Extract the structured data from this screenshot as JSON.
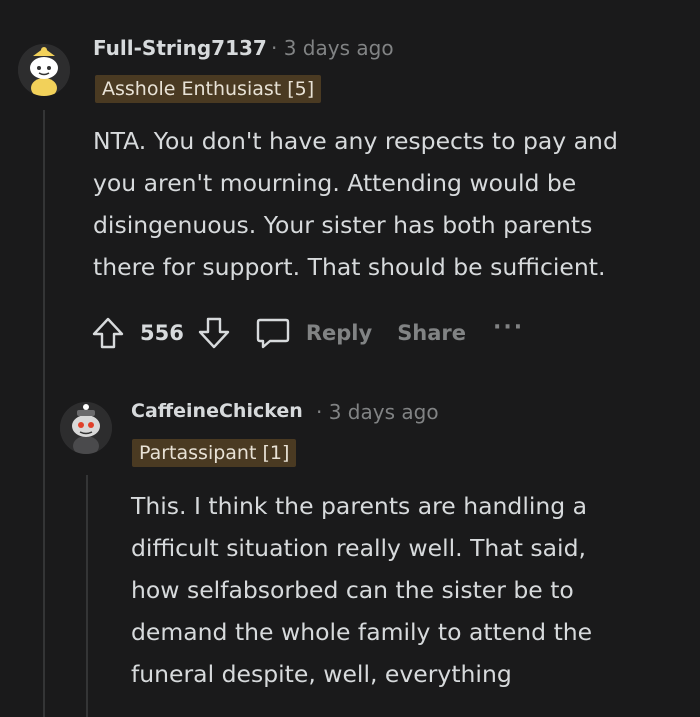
{
  "comments": [
    {
      "username": "Full-String7137",
      "separator": "·",
      "time": "3 days ago",
      "flair": "Asshole Enthusiast [5]",
      "body": [
        "NTA. You don't have any respects to pay and",
        "you aren't mourning. Attending would be",
        "disingenuous. Your sister has both parents",
        "there for support. That should be sufficient."
      ],
      "score": "556",
      "reply_label": "Reply",
      "share_label": "Share",
      "more_label": "···"
    },
    {
      "username": "CaffeineChicken",
      "separator": "·",
      "time": "3 days ago",
      "flair": "Partassipant [1]",
      "body": [
        "This. I think the parents are handling a",
        "difficult situation really well. That said,",
        "how selfabsorbed can the sister be to",
        "demand the whole family to attend the",
        "funeral despite, well, everything"
      ]
    }
  ]
}
